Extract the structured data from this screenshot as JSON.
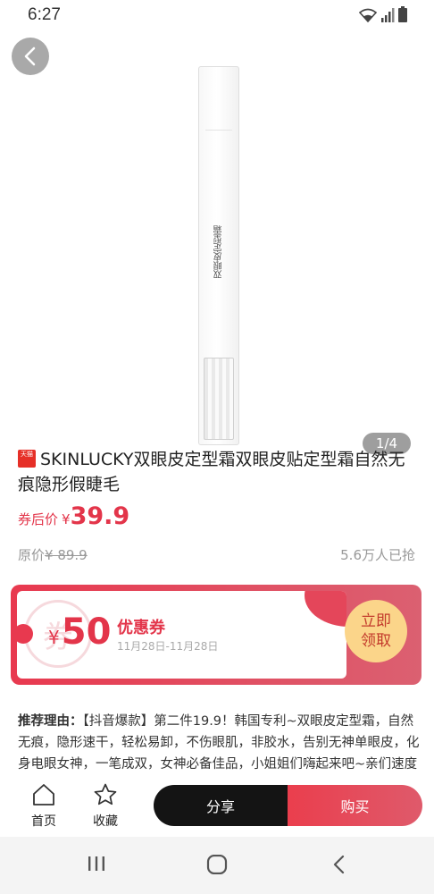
{
  "status_bar": {
    "time": "6:27"
  },
  "product": {
    "image_counter": "1/4",
    "pen_label": "双眼皮定型霜",
    "badge_text": "天猫",
    "title": "SKINLUCKY双眼皮定型霜双眼皮贴定型霜自然无痕隐形假睫毛",
    "price_label": "券后价",
    "price_currency": "¥",
    "price_value": "39.9",
    "original_price_label": "原价",
    "original_price": "¥ 89.9",
    "sold_count": "5.6万人已抢"
  },
  "coupon": {
    "watermark": "券",
    "currency": "¥",
    "amount": "50",
    "title": "优惠券",
    "date_range": "11月28日-11月28日",
    "claim_line1": "立即",
    "claim_line2": "领取"
  },
  "recommendation": {
    "label": "推荐理由：",
    "text": "【抖音爆款】第二件19.9！韩国专利~双眼皮定型霜，自然无痕，隐形速干，轻松易卸，不伤眼肌，非胶水，告别无神单眼皮，化身电眼女神，一笔成双，女神必备佳品，小姐姐们嗨起来吧~亲们速度抢购"
  },
  "bottom_bar": {
    "home_label": "首页",
    "favorite_label": "收藏",
    "share_label": "分享",
    "buy_label": "购买"
  },
  "icons": {
    "back": "chevron-left-icon",
    "home": "home-icon",
    "favorite": "star-icon",
    "wifi": "wifi-icon",
    "signal": "signal-icon",
    "battery": "battery-icon"
  },
  "colors": {
    "accent": "#e3354a",
    "claim_bg": "#fbd58a",
    "share_bg": "#141414"
  }
}
